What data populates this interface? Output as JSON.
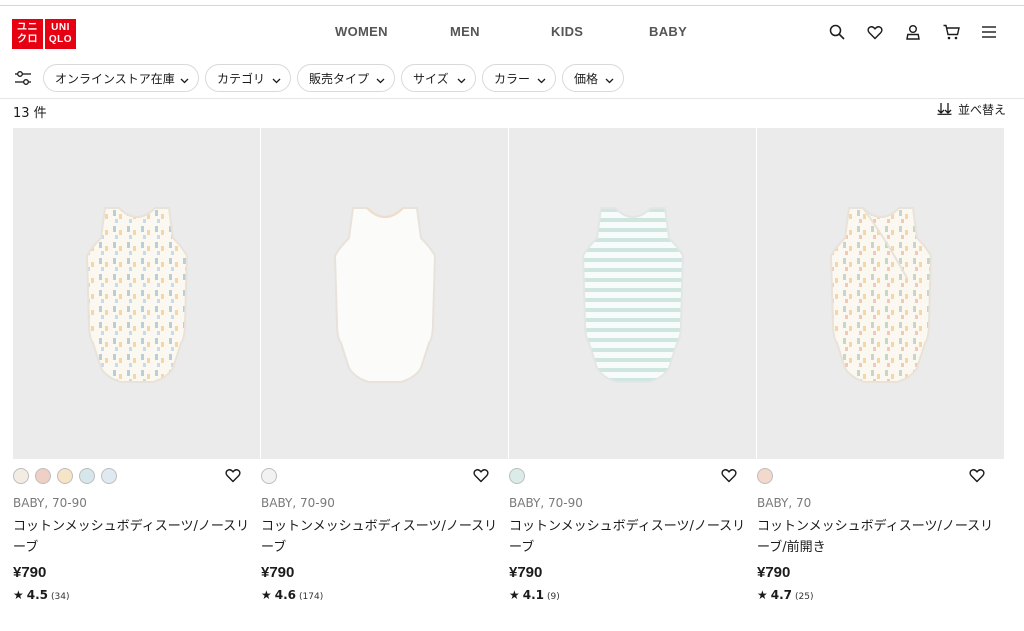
{
  "brand": {
    "logo_text_1": "ユニクロ",
    "logo_text_2": "UNIQLO",
    "color": "#e60012"
  },
  "nav": {
    "women": "WOMEN",
    "men": "MEN",
    "kids": "KIDS",
    "baby": "BABY"
  },
  "header_icons": [
    "search-icon",
    "heart-icon",
    "account-icon",
    "cart-icon",
    "menu-icon"
  ],
  "filters": {
    "items": [
      "オンラインストア在庫",
      "カテゴリ",
      "販売タイプ",
      "サイズ",
      "カラー",
      "価格"
    ]
  },
  "results": {
    "count": "13 件",
    "sort_label": "並べ替え"
  },
  "products": [
    {
      "meta": "BABY, 70-90",
      "name": "コットンメッシュボディスーツ/ノースリーブ",
      "price": "¥790",
      "rating": "4.5",
      "reviews": "(34)",
      "swatches": [
        "#f3ece4",
        "#f0cfc4",
        "#f6e4c6",
        "#d5e7ea",
        "#dfe9f2"
      ]
    },
    {
      "meta": "BABY, 70-90",
      "name": "コットンメッシュボディスーツ/ノースリーブ",
      "price": "¥790",
      "rating": "4.6",
      "reviews": "(174)",
      "swatches": [
        "#f2f2f2"
      ]
    },
    {
      "meta": "BABY, 70-90",
      "name": "コットンメッシュボディスーツ/ノースリーブ",
      "price": "¥790",
      "rating": "4.1",
      "reviews": "(9)",
      "swatches": [
        "#dbece8"
      ]
    },
    {
      "meta": "BABY, 70",
      "name": "コットンメッシュボディスーツ/ノースリーブ/前開き",
      "price": "¥790",
      "rating": "4.7",
      "reviews": "(25)",
      "swatches": [
        "#f3d8cc"
      ]
    }
  ]
}
